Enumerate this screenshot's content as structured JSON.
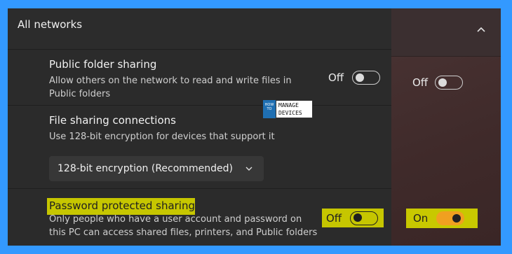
{
  "section": {
    "title": "All networks"
  },
  "public_folder": {
    "title": "Public folder sharing",
    "desc1": "Allow others on the network to read and write files in",
    "desc2": "Public folders",
    "state": "Off"
  },
  "file_sharing": {
    "title": "File sharing connections",
    "desc": "Use 128-bit encryption for devices that support it",
    "dropdown_value": "128-bit encryption (Recommended)"
  },
  "password_sharing": {
    "title": "Password protected sharing",
    "desc1": "Only people who have a user account and password on",
    "desc2": "this PC can access shared files, printers, and Public folders",
    "state": "Off"
  },
  "background_panel": {
    "public_state": "Off",
    "password_state": "On"
  },
  "logo": {
    "line1": "HOW TO",
    "line2": "MANAGE",
    "line3": "DEVICES"
  },
  "colors": {
    "highlight": "#c6c600",
    "toggle_on": "#f0a020",
    "frame_border": "#3399ff"
  }
}
